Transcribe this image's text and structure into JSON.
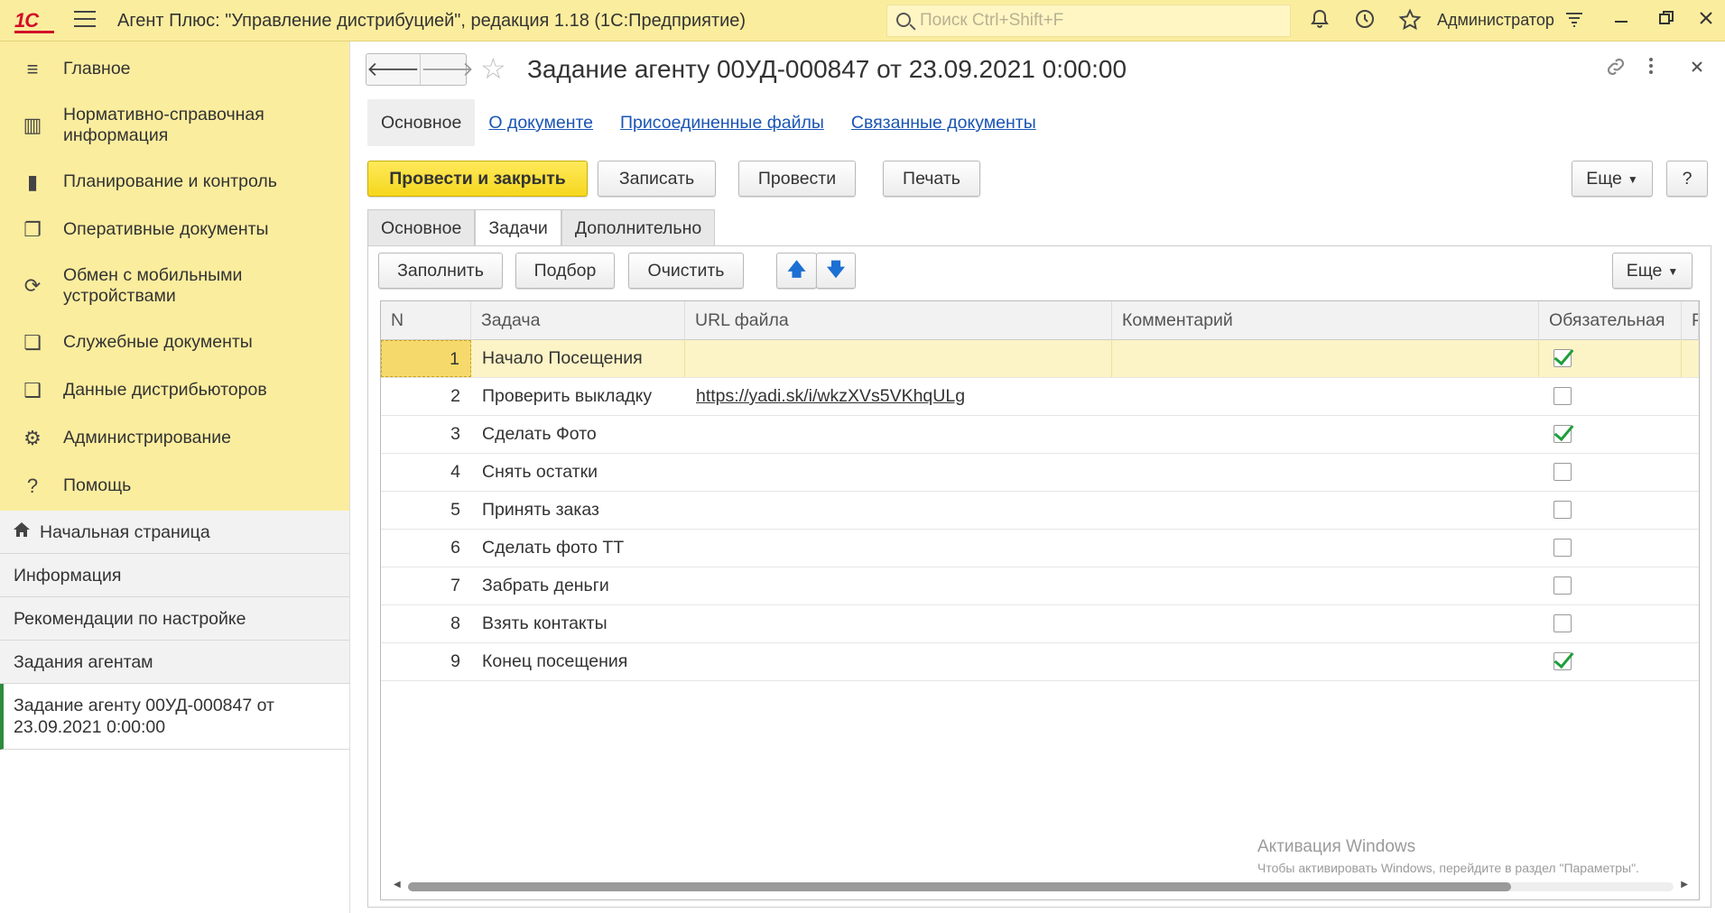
{
  "topbar": {
    "logo": "1С",
    "app_title": "Агент Плюс: \"Управление дистрибуцией\", редакция 1.18  (1С:Предприятие)",
    "search_placeholder": "Поиск Ctrl+Shift+F",
    "user": "Администратор"
  },
  "sidebar": {
    "sections": [
      {
        "label": "Главное",
        "icon": "list-icon"
      },
      {
        "label": "Нормативно-справочная информация",
        "icon": "catalog-icon"
      },
      {
        "label": "Планирование и контроль",
        "icon": "chart-icon"
      },
      {
        "label": "Оперативные документы",
        "icon": "documents-icon"
      },
      {
        "label": "Обмен с мобильными устройствами",
        "icon": "sync-icon"
      },
      {
        "label": "Служебные документы",
        "icon": "service-docs-icon"
      },
      {
        "label": "Данные дистрибьюторов",
        "icon": "distributor-icon"
      },
      {
        "label": "Администрирование",
        "icon": "gear-icon"
      },
      {
        "label": "Помощь",
        "icon": "help-icon"
      }
    ],
    "nav": {
      "home": "Начальная страница",
      "info": "Информация",
      "recommendations": "Рекомендации по настройке",
      "agent_tasks": "Задания агентам",
      "current": "Задание агенту 00УД-000847 от 23.09.2021 0:00:00"
    }
  },
  "document": {
    "title": "Задание агенту 00УД-000847 от 23.09.2021 0:00:00",
    "form_tabs": [
      "Основное",
      "О документе",
      "Присоединенные файлы",
      "Связанные документы"
    ],
    "toolbar": {
      "post_and_close": "Провести и закрыть",
      "save": "Записать",
      "post": "Провести",
      "print": "Печать",
      "more": "Еще",
      "help": "?"
    },
    "page_tabs": [
      "Основное",
      "Задачи",
      "Дополнительно"
    ],
    "tasks_toolbar": {
      "fill": "Заполнить",
      "pick": "Подбор",
      "clear": "Очистить",
      "more": "Еще"
    },
    "table": {
      "columns": [
        "N",
        "Задача",
        "URL файла",
        "Комментарий",
        "Обязательная",
        "Р"
      ],
      "rows": [
        {
          "n": "1",
          "task": "Начало Посещения",
          "url": "",
          "comment": "",
          "required": true
        },
        {
          "n": "2",
          "task": "Проверить выкладку",
          "url": "https://yadi.sk/i/wkzXVs5VKhqULg",
          "comment": "",
          "required": false
        },
        {
          "n": "3",
          "task": "Сделать Фото",
          "url": "",
          "comment": "",
          "required": true
        },
        {
          "n": "4",
          "task": "Снять остатки",
          "url": "",
          "comment": "",
          "required": false
        },
        {
          "n": "5",
          "task": "Принять заказ",
          "url": "",
          "comment": "",
          "required": false
        },
        {
          "n": "6",
          "task": "Сделать фото ТТ",
          "url": "",
          "comment": "",
          "required": false
        },
        {
          "n": "7",
          "task": "Забрать деньги",
          "url": "",
          "comment": "",
          "required": false
        },
        {
          "n": "8",
          "task": "Взять контакты",
          "url": "",
          "comment": "",
          "required": false
        },
        {
          "n": "9",
          "task": "Конец посещения",
          "url": "",
          "comment": "",
          "required": true
        }
      ]
    }
  },
  "watermark": {
    "line1": "Активация Windows",
    "line2": "Чтобы активировать Windows, перейдите в раздел \"Параметры\"."
  }
}
